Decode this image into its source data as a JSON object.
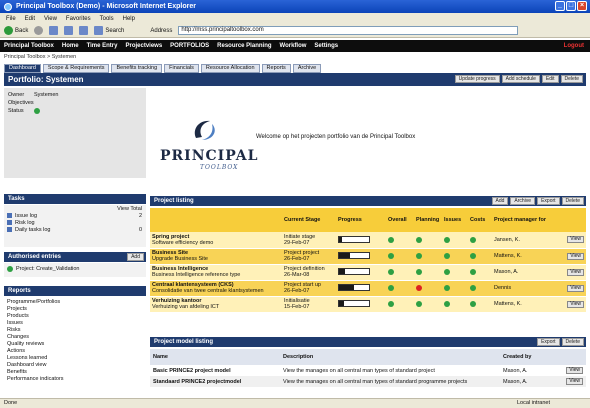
{
  "window": {
    "title": "Principal Toolbox (Demo) - Microsoft Internet Explorer"
  },
  "menu": [
    "File",
    "Edit",
    "View",
    "Favorites",
    "Tools",
    "Help"
  ],
  "toolbar": {
    "back": "Back",
    "search": "Search",
    "address_label": "Address",
    "address": "http://mss.principaltoolbox.com"
  },
  "topnav": {
    "items": [
      "Principal Toolbox",
      "Home",
      "Time Entry",
      "Projectviews",
      "PORTFOLIOS",
      "Resource Planning",
      "Workflow",
      "Settings"
    ],
    "logout": "Logout"
  },
  "breadcrumb": "Principal Toolbox > Systemen",
  "tabs": [
    "Dashboard",
    "Scope & Requirements",
    "Benefits tracking",
    "Financials",
    "Resource Allocation",
    "Reports",
    "Archive"
  ],
  "portfolio": {
    "title": "Portfolio: Systemen",
    "buttons": [
      "Update progress",
      "Add schedule",
      "Edit",
      "Delete"
    ]
  },
  "info": {
    "owner_label": "Owner",
    "owner_value": "Systemen",
    "objectives_label": "Objectives",
    "status_label": "Status",
    "status_color": "#2ea043"
  },
  "logo": {
    "name": "PRINCIPAL",
    "sub": "TOOLBOX"
  },
  "welcome": "Welcome op het projecten portfolio van de Principal Toolbox",
  "tasks": {
    "title": "Tasks",
    "header": "View  Total",
    "items": [
      {
        "label": "Issue log",
        "count": "2"
      },
      {
        "label": "Risk log",
        "count": ""
      },
      {
        "label": "Daily tasks log",
        "count": "0"
      }
    ]
  },
  "authorized": {
    "title": "Authorised entries",
    "button": "Add",
    "item": "Project: Create_Validation"
  },
  "reports": {
    "title": "Reports",
    "items": [
      "Programme/Portfolios",
      "Projects",
      "Products",
      "Issues",
      "Risks",
      "Changes",
      "Quality reviews",
      "Actions",
      "Lessons learned",
      "Dashboard view",
      "Benefits",
      "Performance indicators"
    ]
  },
  "project_listing": {
    "title": "Project listing",
    "buttons": [
      "Add",
      "Archive",
      "Export",
      "Delete"
    ],
    "columns": [
      "",
      "Current Stage",
      "Progress",
      "Overall",
      "Planning",
      "Issues",
      "Costs",
      "Project manager for"
    ],
    "rows": [
      {
        "name": "Spring project",
        "desc": "Software efficiency demo",
        "stage": "Initiate stage",
        "date": "29-Feb-07",
        "progress": 0.1,
        "s": [
          "green",
          "green",
          "green",
          "green"
        ],
        "pm": "Jansen, K.",
        "style": "light"
      },
      {
        "name": "Business Site",
        "desc": "Upgrade Business Site",
        "stage": "Project project",
        "date": "26-Feb-07",
        "progress": 0.35,
        "s": [
          "green",
          "green",
          "green",
          "green"
        ],
        "pm": "Mattens, K.",
        "style": "dark"
      },
      {
        "name": "Business Intelligence",
        "desc": "Business Intelligence reference type",
        "stage": "Project definition",
        "date": "26-Mar-08",
        "progress": 0.2,
        "s": [
          "green",
          "green",
          "green",
          "green"
        ],
        "pm": "Mason, A.",
        "style": "light"
      },
      {
        "name": "Centraal klantensysteem (CKS)",
        "desc": "Consolidatie van twee centrale klantsystemen",
        "stage": "Project start up",
        "date": "26-Feb-07",
        "progress": 0.5,
        "s": [
          "green",
          "red",
          "green",
          "green"
        ],
        "pm": "Dennis",
        "style": "dark"
      },
      {
        "name": "Verhuizing kantoor",
        "desc": "Verhuizing van afdeling ICT",
        "stage": "Initialisatie",
        "date": "15-Feb-07",
        "progress": 0.15,
        "s": [
          "green",
          "green",
          "green",
          "green"
        ],
        "pm": "Mattens, K.",
        "style": "light"
      }
    ],
    "view_label": "View"
  },
  "model_listing": {
    "title": "Project model listing",
    "buttons": [
      "Export",
      "Delete"
    ],
    "columns": [
      "Name",
      "Description",
      "Created by"
    ],
    "rows": [
      {
        "name": "Basic PRINCE2 project model",
        "desc": "View the manages on all central man types of standard project",
        "by": "Mason, A."
      },
      {
        "name": "Standaard PRINCE2 projectmodel",
        "desc": "View the manages on all central man types of standard programme projects",
        "by": "Mason, A."
      }
    ],
    "view_label": "View"
  },
  "status": {
    "left": "Done",
    "zone": "Local intranet"
  },
  "colors": {
    "nav": "#1f3b6e",
    "accent": "#f7cd3a",
    "green": "#2ea043",
    "red": "#d22222"
  }
}
